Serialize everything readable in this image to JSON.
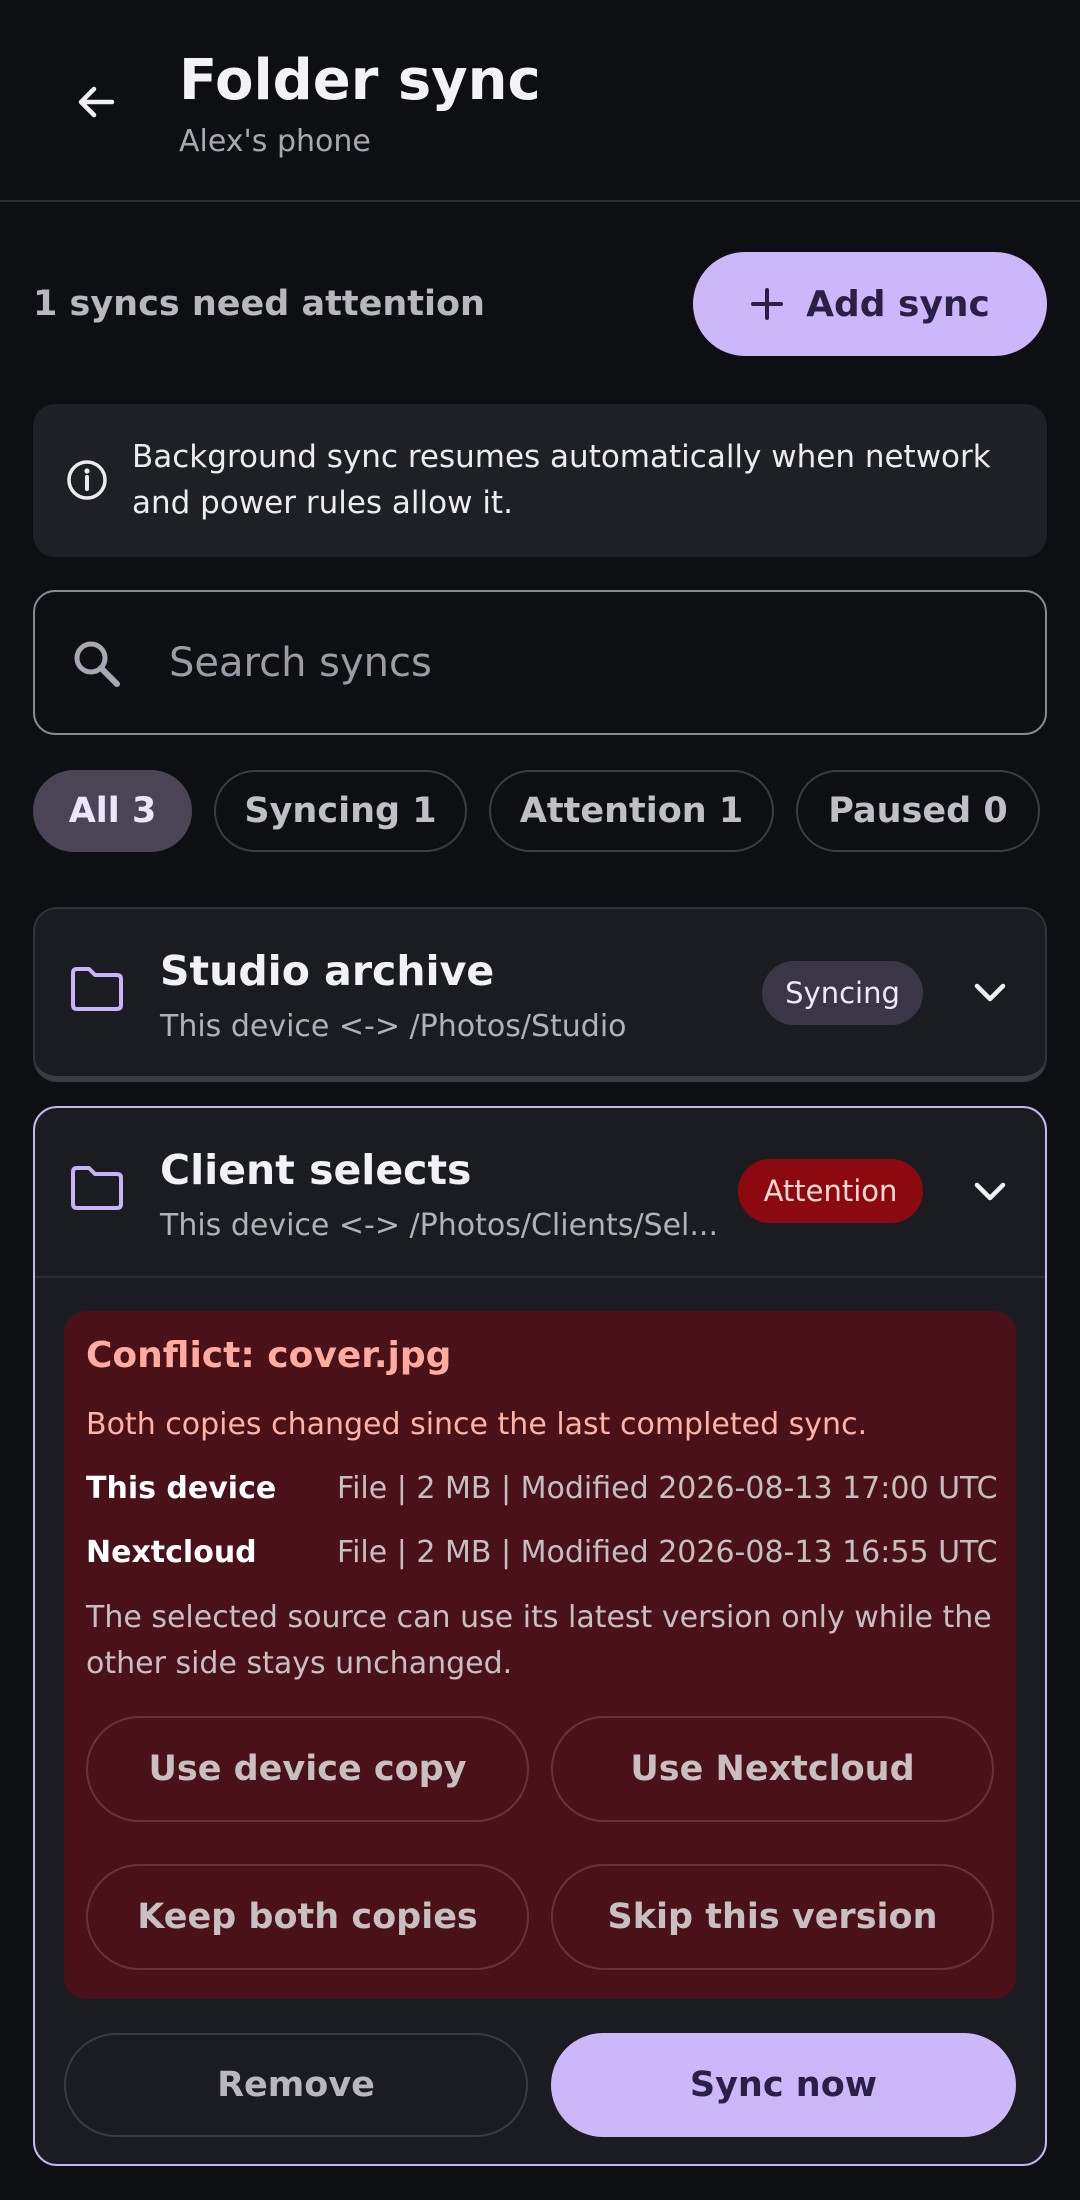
{
  "header": {
    "title": "Folder sync",
    "subtitle": "Alex's phone",
    "back_icon": "arrow-left-icon"
  },
  "summary": {
    "attention_text": "1 syncs need attention",
    "add_label": "Add sync"
  },
  "info": {
    "text": "Background sync resumes automatically when network and power rules allow it."
  },
  "search": {
    "placeholder": "Search syncs"
  },
  "filters": [
    {
      "label": "All 3",
      "active": true
    },
    {
      "label": "Syncing 1",
      "active": false
    },
    {
      "label": "Attention 1",
      "active": false
    },
    {
      "label": "Paused 0",
      "active": false
    }
  ],
  "syncs": [
    {
      "name": "Studio archive",
      "path": "This device <-> /Photos/Studio",
      "status": "Syncing"
    },
    {
      "name": "Client selects",
      "path": "This device <-> /Photos/Clients/Sel...",
      "status": "Attention",
      "conflict": {
        "title": "Conflict: cover.jpg",
        "description": "Both copies changed since the last completed sync.",
        "rows": [
          {
            "label": "This device",
            "value": "File | 2 MB | Modified 2026-08-13 17:00 UTC"
          },
          {
            "label": "Nextcloud",
            "value": "File | 2 MB | Modified 2026-08-13 16:55 UTC"
          }
        ],
        "note": "The selected source can use its latest version only while the other side stays unchanged.",
        "options": [
          "Use device copy",
          "Use Nextcloud",
          "Keep both copies",
          "Skip this version"
        ]
      },
      "actions": {
        "remove": "Remove",
        "sync_now": "Sync now"
      }
    }
  ],
  "colors": {
    "background": "#0e0f13",
    "accent": "#cdb7fb",
    "attention": "#8c0a0f",
    "conflict_bg": "#4b1118"
  }
}
